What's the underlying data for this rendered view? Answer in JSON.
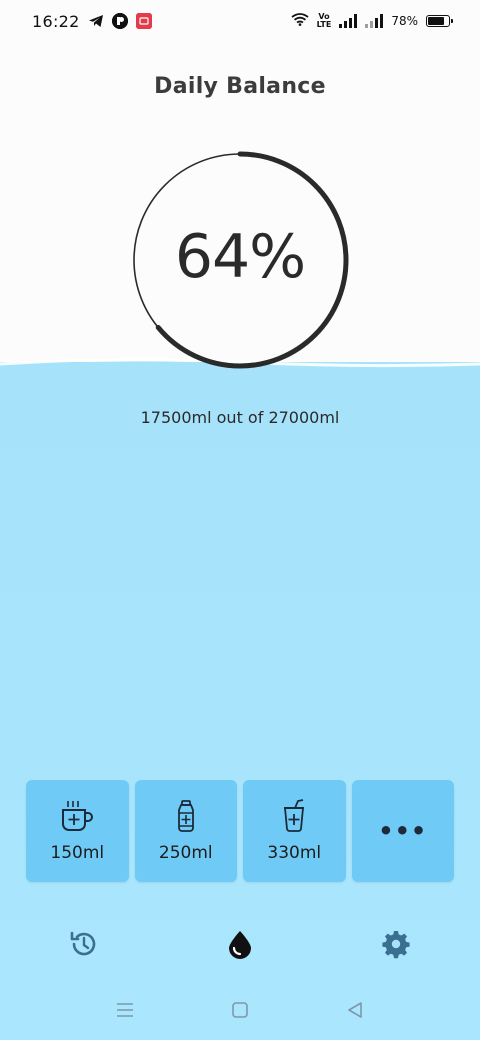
{
  "status_bar": {
    "time": "16:22",
    "battery_percent": "78%",
    "battery_level": 0.78,
    "icons": [
      "telegram-icon",
      "app-notification-icon",
      "red-app-notification-icon",
      "wifi-icon",
      "volte-icon",
      "signal-icon",
      "signal-icon-2",
      "battery-icon"
    ],
    "volte_top": "Vo",
    "volte_bottom": "LTE"
  },
  "app": {
    "title": "Daily Balance",
    "progress_fraction": 0.64,
    "percent_text": "64%",
    "amount_text": "17500ml out of 27000ml"
  },
  "colors": {
    "water": "#a6e3fb",
    "button": "#6fcbf6",
    "icon": "#3a6f8f",
    "ring": "#2a2a2a"
  },
  "quick_add": [
    {
      "label": "150ml",
      "icon": "hot-cup-icon"
    },
    {
      "label": "250ml",
      "icon": "bottle-icon"
    },
    {
      "label": "330ml",
      "icon": "soda-cup-icon"
    },
    {
      "label": "•••",
      "icon": "more-icon"
    }
  ],
  "bottom_nav": [
    "history-icon",
    "water-drop-icon",
    "settings-icon"
  ],
  "system_nav": [
    "menu-icon",
    "home-icon",
    "back-icon"
  ]
}
